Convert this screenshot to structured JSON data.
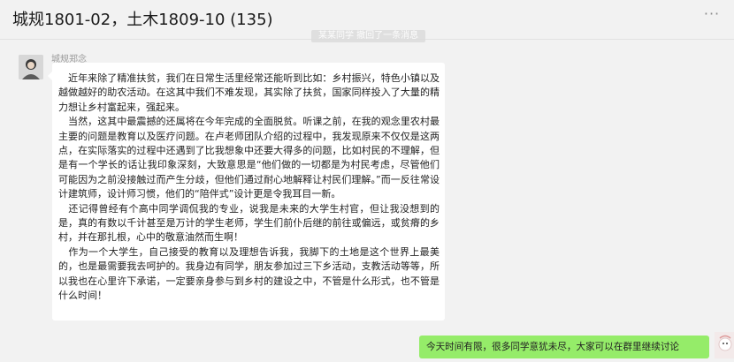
{
  "chat": {
    "title": "城规1801-02，土木1809-10 (135)"
  },
  "header": {
    "more_label": "···",
    "more_icon": "more-icon"
  },
  "system_notice": "某某同学  撤回了一条消息",
  "message": {
    "sender": "城规郑念",
    "paragraphs": [
      "　近年来除了精准扶贫，我们在日常生活里经常还能听到比如：乡村振兴，特色小镇以及越做越好的助农活动。在这其中我们不难发现，其实除了扶贫，国家同样投入了大量的精力想让乡村富起来，强起来。",
      "　当然，这其中最震撼的还属将在今年完成的全面脱贫。听课之前，在我的观念里农村最主要的问题是教育以及医疗问题。在卢老师团队介绍的过程中，我发现原来不仅仅是这两点，在实际落实的过程中还遇到了比我想象中还要大得多的问题，比如村民的不理解，但是有一个学长的话让我印象深刻，大致意思是“他们做的一切都是为村民考虑，尽管他们可能因为之前没接触过而产生分歧，但他们通过耐心地解释让村民们理解。”而一反往常设计建筑师，设计师习惯，他们的“陪伴式”设计更是令我耳目一新。",
      "　还记得曾经有个高中同学调侃我的专业，说我是未来的大学生村官，但让我没想到的是，真的有数以千计甚至是万计的学生老师，学生们前仆后继的前往或偏远，或贫瘠的乡村，并在那扎根，心中的敬意油然而生啊！",
      "　作为一个大学生，自己接受的教育以及理想告诉我，我脚下的土地是这个世界上最美的，也是最需要我去呵护的。我身边有同学，朋友参加过三下乡活动，支教活动等等，所以我也在心里许下承诺，一定要亲身参与到乡村的建设之中，不管是什么形式，也不管是什么时间！"
    ]
  },
  "reply": {
    "text": "今天时间有限，很多同学意犹未尽，大家可以在群里继续讨论"
  },
  "colors": {
    "background": "#f2f2f2",
    "bubble_incoming": "#ffffff",
    "bubble_outgoing": "#95ec69"
  }
}
